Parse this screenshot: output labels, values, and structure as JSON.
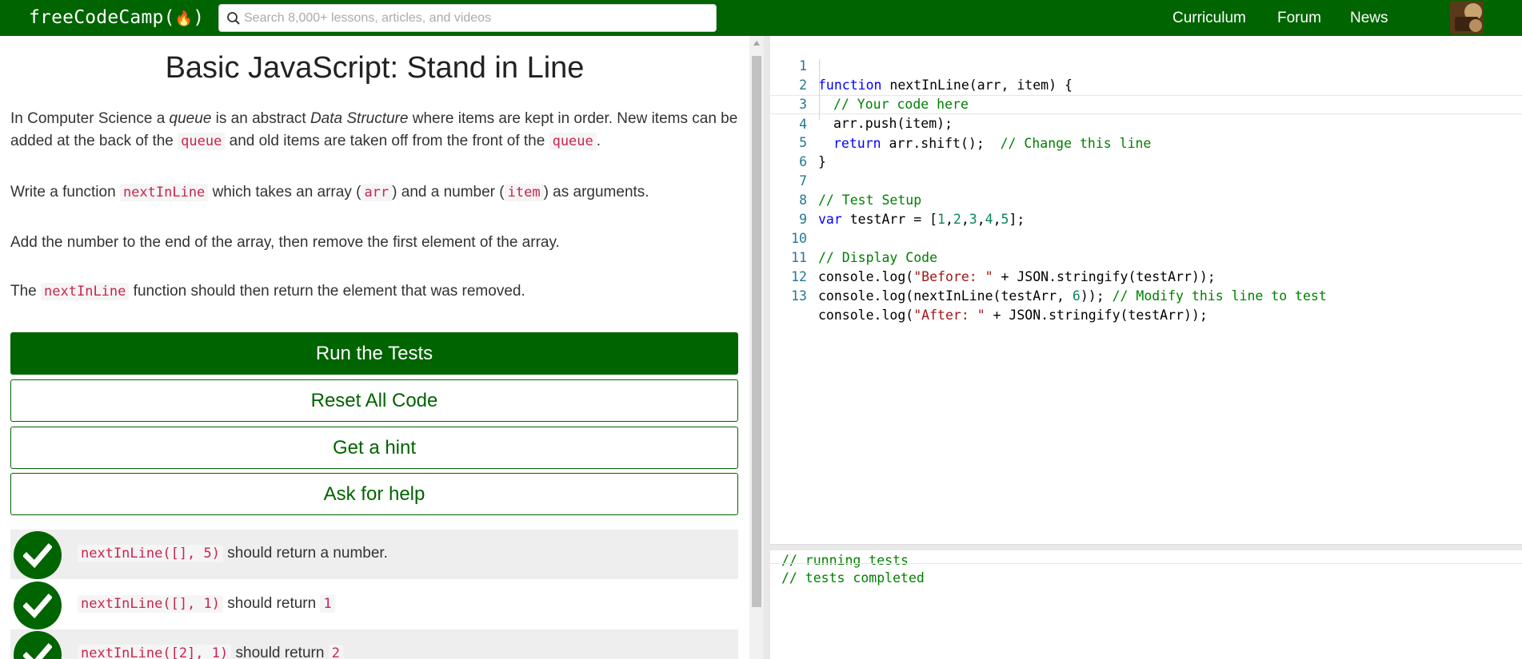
{
  "header": {
    "logo_text": "freeCodeCamp(",
    "logo_flame": "🔥",
    "logo_close": ")",
    "search_placeholder": "Search 8,000+ lessons, articles, and videos",
    "nav": [
      "Curriculum",
      "Forum",
      "News"
    ],
    "colors": {
      "brand": "#006400"
    }
  },
  "challenge": {
    "title": "Basic JavaScript: Stand in Line",
    "para1": {
      "t1": "In Computer Science a ",
      "em1": "queue",
      "t2": " is an abstract ",
      "em2": "Data Structure",
      "t3": " where items are kept in order. New items can be added at the back of the ",
      "code1": "queue",
      "t4": " and old items are taken off from the front of the ",
      "code2": "queue",
      "t5": "."
    },
    "para2": {
      "t1": "Write a function ",
      "code1": "nextInLine",
      "t2": " which takes an array (",
      "code2": "arr",
      "t3": ") and a number (",
      "code3": "item",
      "t4": ") as arguments."
    },
    "para3": "Add the number to the end of the array, then remove the first element of the array.",
    "para4": {
      "t1": "The ",
      "code1": "nextInLine",
      "t2": " function should then return the element that was removed."
    }
  },
  "buttons": {
    "run": "Run the Tests",
    "reset": "Reset All Code",
    "hint": "Get a hint",
    "help": "Ask for help"
  },
  "tests": [
    {
      "code": "nextInLine([], 5)",
      "text": " should return a number.",
      "ret": ""
    },
    {
      "code": "nextInLine([], 1)",
      "text": " should return ",
      "ret": "1"
    },
    {
      "code": "nextInLine([2], 1)",
      "text": " should return ",
      "ret": "2"
    }
  ],
  "editor": {
    "line_numbers": [
      "1",
      "2",
      "3",
      "4",
      "5",
      "6",
      "7",
      "8",
      "9",
      "10",
      "11",
      "12",
      "13"
    ],
    "l1": {
      "kw": "function",
      "rest": " nextInLine(arr, item) {"
    },
    "l2": {
      "cm": "// Your code here"
    },
    "l3": {
      "rest": "arr.push(item);"
    },
    "l4": {
      "kw": "return",
      "rest": " arr.shift();  ",
      "cm": "// Change this line"
    },
    "l5": {
      "rest": "}"
    },
    "l7": {
      "cm": "// Test Setup"
    },
    "l8": {
      "kw": "var",
      "rest": " testArr = [",
      "n1": "1",
      "n2": "2",
      "n3": "3",
      "n4": "4",
      "n5": "5",
      "end": "];"
    },
    "l10": {
      "cm": "// Display Code"
    },
    "l11": {
      "a": "console.log(",
      "s": "\"Before: \"",
      "b": " + JSON.stringify(testArr));"
    },
    "l12": {
      "a": "console.log(nextInLine(testArr, ",
      "n": "6",
      "b": ")); ",
      "cm": "// Modify this line to test"
    },
    "l13": {
      "a": "console.log(",
      "s": "\"After: \"",
      "b": " + JSON.stringify(testArr));"
    }
  },
  "console": {
    "lines": [
      "// running tests",
      "// tests completed"
    ]
  }
}
